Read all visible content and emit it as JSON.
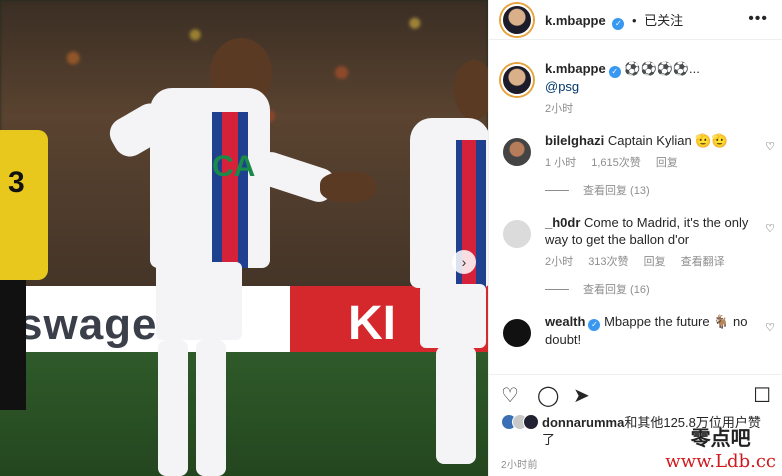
{
  "post": {
    "username": "k.mbappe",
    "verified_icon": "verified-badge-icon",
    "follow_status": "已关注",
    "caption_text": "⚽⚽⚽⚽...",
    "caption_mention": "@psg",
    "caption_time": "2小时"
  },
  "photo": {
    "board_left": "swage",
    "board_right": "KI",
    "player_sponsor": "CA",
    "yellow_number": "3"
  },
  "comments": [
    {
      "user": "bilelghazi",
      "text": "Captain Kylian 🫡🫡",
      "time": "1 小时",
      "likes": "1,615次赞",
      "reply": "回复",
      "view_replies": "查看回复 (13)"
    },
    {
      "user": "_h0dr",
      "text": "Come to Madrid, it's the only way to get the ballon d'or",
      "time": "2小时",
      "likes": "313次赞",
      "reply": "回复",
      "translate": "查看翻译",
      "view_replies": "查看回复 (16)"
    },
    {
      "user": "wealth",
      "text": "Mbappe the future 🐐 no doubt!",
      "verified": true
    }
  ],
  "likes_line": {
    "user": "donnarumma",
    "text": "和其他125.8万位用户赞了"
  },
  "footer": {
    "timestamp": "2小时前"
  },
  "watermark": {
    "line1": "零点吧",
    "line2": "www.Ldb.cc"
  },
  "colors": {
    "verified_blue": "#3897f0",
    "link_blue": "#00376b",
    "muted_gray": "#8e8e8e",
    "watermark_red": "#d0191e"
  }
}
